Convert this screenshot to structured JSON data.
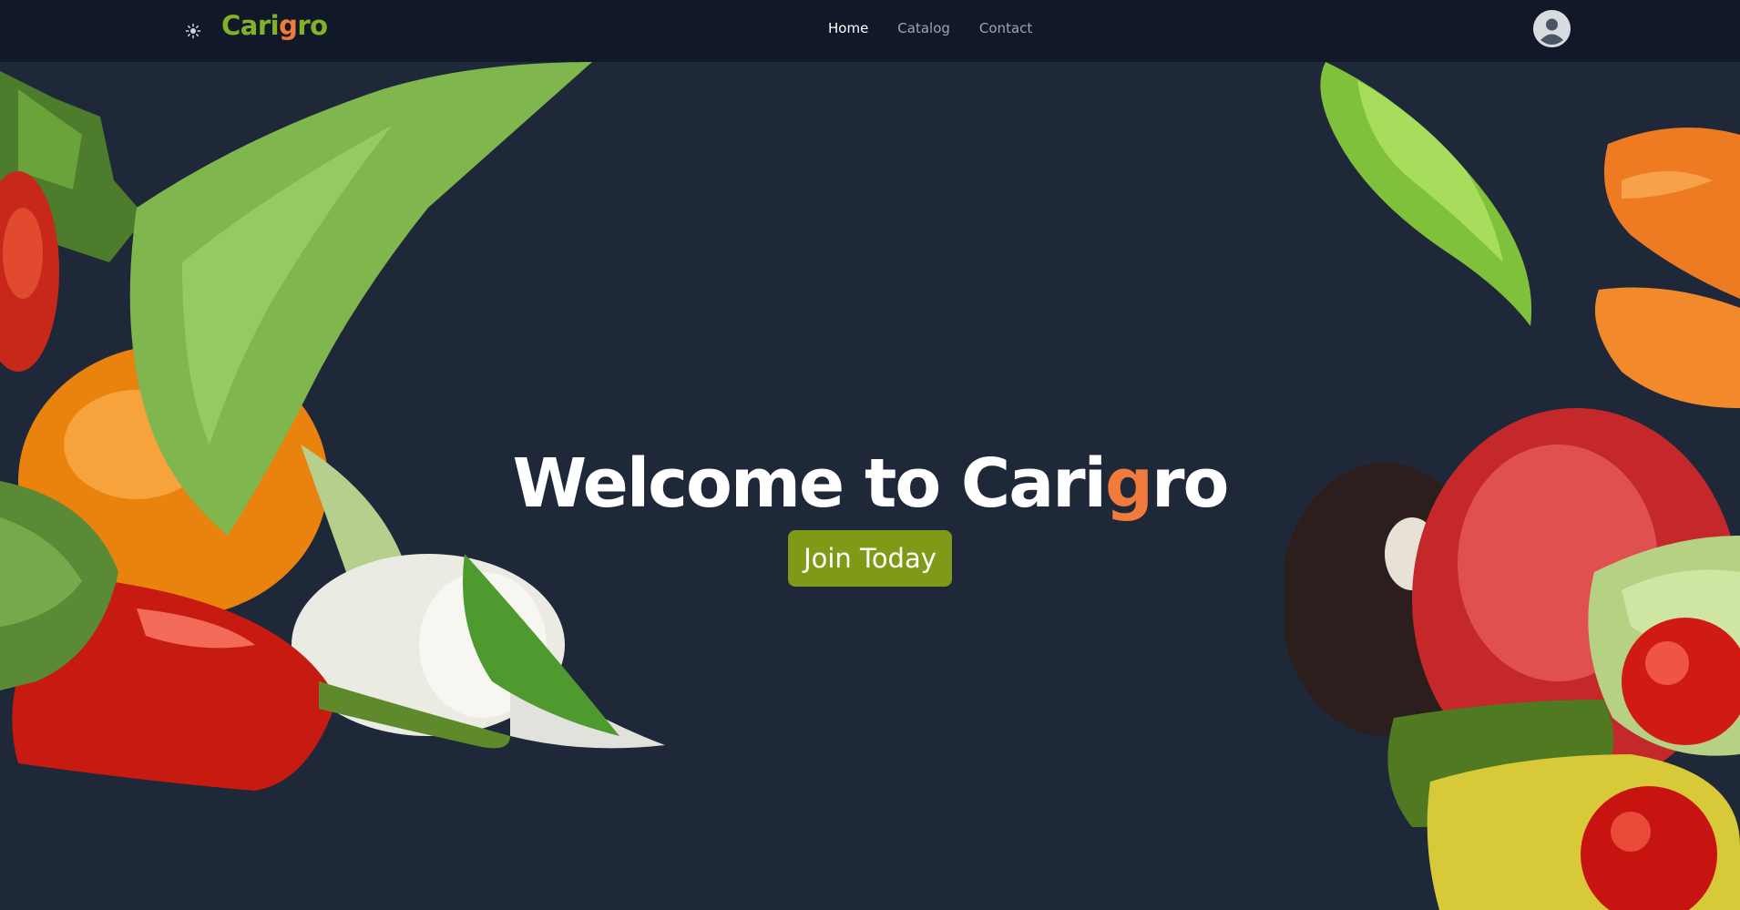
{
  "header": {
    "theme_icon": "sun-icon",
    "logo": {
      "prefix": "Cari",
      "accent": "g",
      "suffix": "ro"
    },
    "nav": [
      {
        "label": "Home",
        "active": true
      },
      {
        "label": "Catalog",
        "active": false
      },
      {
        "label": "Contact",
        "active": false
      }
    ],
    "avatar_icon": "user-avatar-icon"
  },
  "hero": {
    "title_prefix": "Welcome to Cari",
    "title_accent": "g",
    "title_suffix": "ro",
    "cta_label": "Join Today"
  },
  "colors": {
    "nav_bg": "#111827",
    "hero_bg": "#1f2838",
    "brand_green": "#84b226",
    "brand_orange": "#f07b3c",
    "cta_bg": "#7f9a16"
  }
}
